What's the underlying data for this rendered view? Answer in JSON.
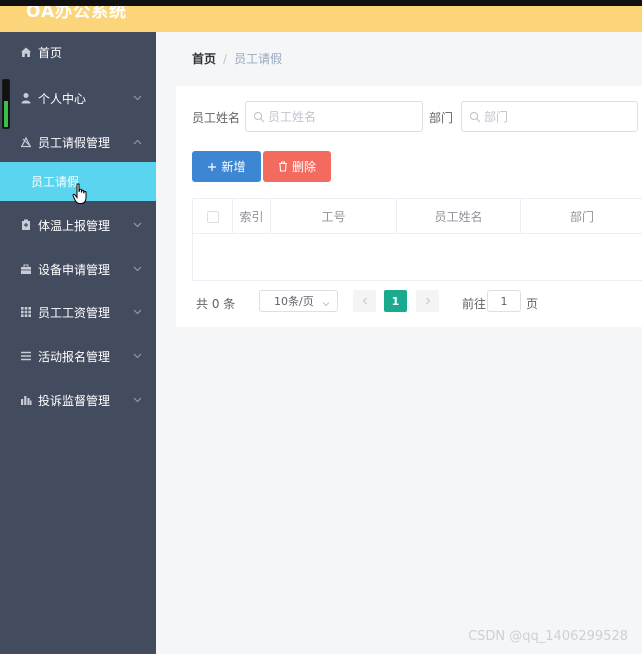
{
  "app": {
    "title": "OA办公系统"
  },
  "sidebar": {
    "items": [
      {
        "label": "首页",
        "icon": "home-icon"
      },
      {
        "label": "个人中心",
        "icon": "user-icon"
      },
      {
        "label": "员工请假管理",
        "icon": "leave-icon"
      },
      {
        "label": "体温上报管理",
        "icon": "thermometer-icon"
      },
      {
        "label": "设备申请管理",
        "icon": "device-icon"
      },
      {
        "label": "员工工资管理",
        "icon": "salary-icon"
      },
      {
        "label": "活动报名管理",
        "icon": "list-icon"
      },
      {
        "label": "投诉监督管理",
        "icon": "complaint-icon"
      }
    ],
    "active_submenu": "员工请假",
    "colors": {
      "background": "#434b5f",
      "active": "#5ad4ef"
    }
  },
  "breadcrumb": {
    "home": "首页",
    "separator": "/",
    "current": "员工请假"
  },
  "search": {
    "name_label": "员工姓名",
    "name_placeholder": "员工姓名",
    "dept_label": "部门",
    "dept_placeholder": "部门"
  },
  "toolbar": {
    "add_label": "新增",
    "delete_label": "删除"
  },
  "table": {
    "columns": [
      "索引",
      "工号",
      "员工姓名",
      "部门"
    ],
    "rows": []
  },
  "pagination": {
    "total_text": "共 0 条",
    "page_size": "10条/页",
    "current_page": "1",
    "goto_label": "前往",
    "goto_value": "1",
    "page_suffix": "页"
  },
  "watermark": "CSDN @qq_1406299528"
}
